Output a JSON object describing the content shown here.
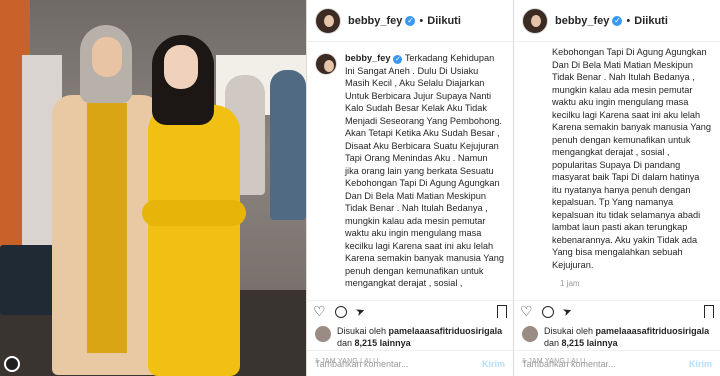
{
  "post": {
    "username": "bebby_fey",
    "follow_label": "Diikuti",
    "separator": "•"
  },
  "caption_left": {
    "username": "bebby_fey",
    "lines": [
      "Terkadang Kehidupan",
      "Ini Sangat Aneh . Dulu Di Usiaku",
      "Masih Kecil , Aku Selalu Diajarkan",
      "Untuk Berbicara Jujur Supaya Nanti",
      "Kalo Sudah Besar Kelak Aku Tidak",
      "Menjadi Seseorang Yang Pembohong.",
      "Akan Tetapi Ketika Aku Sudah Besar ,",
      "Disaat Aku Berbicara Suatu Kejujuran",
      "Tapi Orang Menindas Aku . Namun",
      "jika orang lain yang berkata Sesuatu",
      "Kebohongan Tapi Di Agung Agungkan",
      "Dan Di Bela Mati Matian Meskipun",
      "Tidak Benar . Nah Itulah Bedanya ,",
      "mungkin kalau ada mesin pemutar",
      "waktu aku ingin mengulang masa",
      "kecilku lagi Karena saat ini aku lelah",
      "Karena semakin banyak manusia Yang",
      "penuh dengan kemunafikan untuk",
      "mengangkat derajat , sosial ,"
    ]
  },
  "caption_right": {
    "lines": [
      "Kebohongan Tapi Di Agung Agungkan",
      "Dan Di Bela Mati Matian Meskipun",
      "Tidak Benar . Nah Itulah Bedanya ,",
      "mungkin kalau ada mesin pemutar",
      "waktu aku ingin mengulang masa",
      "kecilku lagi Karena saat ini aku lelah",
      "Karena semakin banyak manusia Yang",
      "penuh dengan kemunafikan untuk",
      "mengangkat derajat , sosial ,",
      "popularitas Supaya Di pandang",
      "masyarat baik Tapi Di dalam hatinya",
      "itu nyatanya hanya penuh dengan",
      "kepalsuan. Tp Yang namanya",
      "kepalsuan itu tidak selamanya abadi",
      "lambat laun pasti akan terungkap",
      "kebenarannya. Aku yakin Tidak ada",
      "Yang bisa mengalahkan sebuah",
      "Kejujuran."
    ],
    "time": "1 jam"
  },
  "likes": {
    "prefix": "Disukai oleh",
    "user": "pamelaaasafitriduosirigala",
    "dan": "dan",
    "count": "8,215 lainnya"
  },
  "ago": "1 JAM YANG LALU",
  "comment": {
    "placeholder": "Tambahkan komentar...",
    "send": "Kirim"
  },
  "colors": {
    "verified": "#3897f0",
    "send_disabled": "#b2dffc"
  }
}
